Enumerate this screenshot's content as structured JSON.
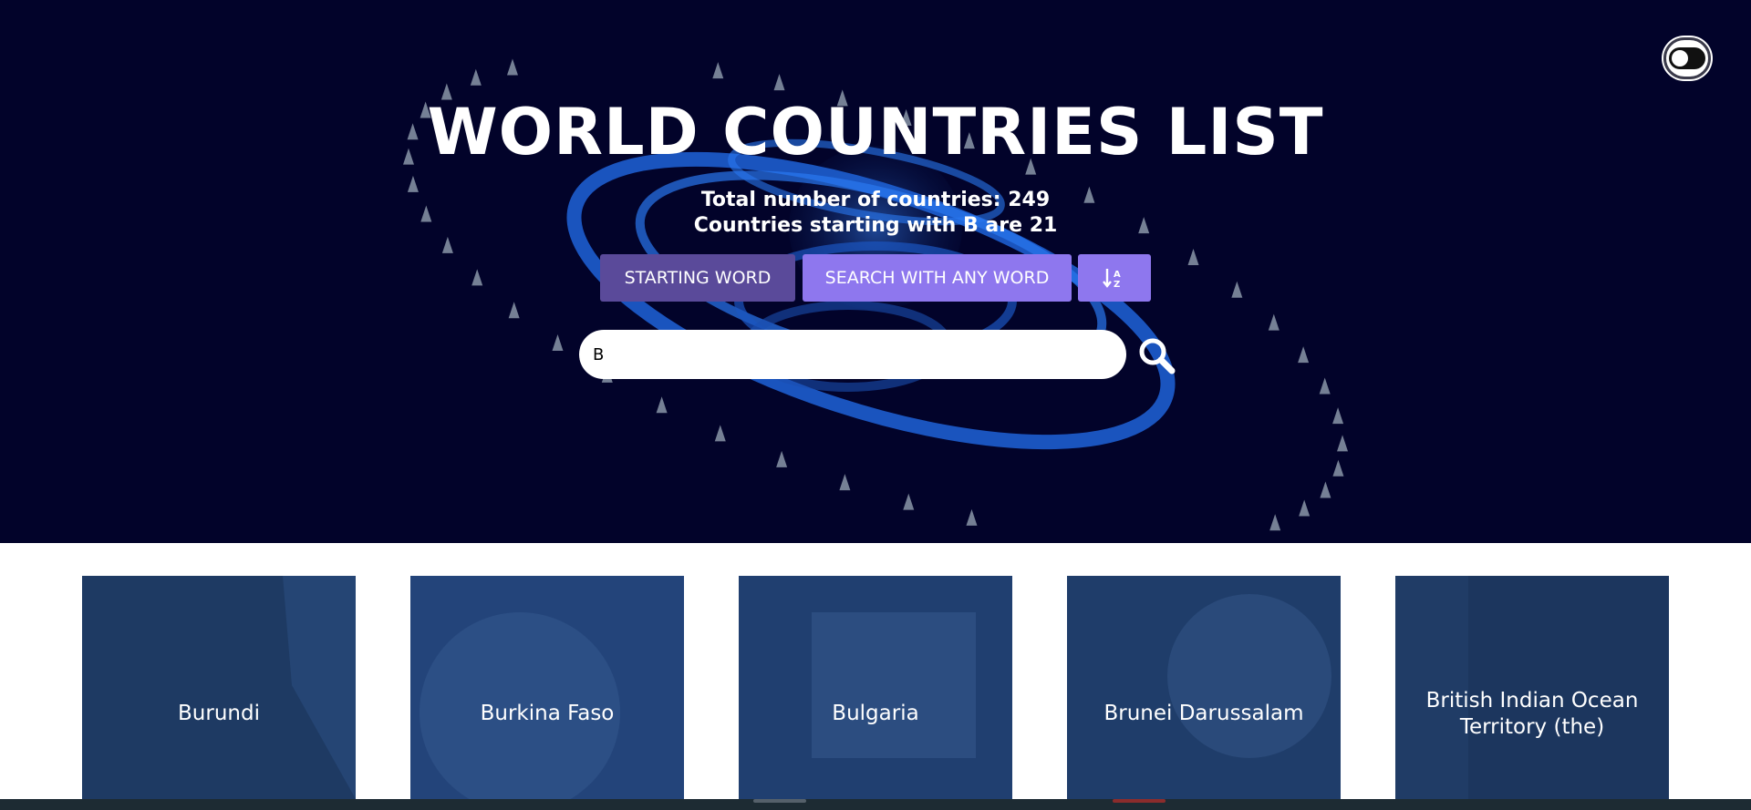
{
  "header": {
    "title": "WORLD COUNTRIES LIST",
    "total_text": "Total number of countries: 249",
    "filter_text": "Countries starting with B are 21"
  },
  "theme_toggle": {
    "icon": "toggle-icon",
    "state": "dark"
  },
  "controls": {
    "starting_word_label": "STARTING WORD",
    "any_word_label": "SEARCH WITH ANY WORD",
    "sort_icon": "sort-alpha-icon",
    "sort_label": "↓Z"
  },
  "search": {
    "value": "B",
    "placeholder": "",
    "icon": "search-icon"
  },
  "countries": [
    {
      "name": "Burundi"
    },
    {
      "name": "Burkina Faso"
    },
    {
      "name": "Bulgaria"
    },
    {
      "name": "Brunei Darussalam"
    },
    {
      "name": "British Indian Ocean Territory (the)"
    }
  ],
  "colors": {
    "hero_bg": "#02032a",
    "button_active": "#5a4a9a",
    "button_accent": "#8e77ee",
    "card_bg": "#1c3a66"
  }
}
